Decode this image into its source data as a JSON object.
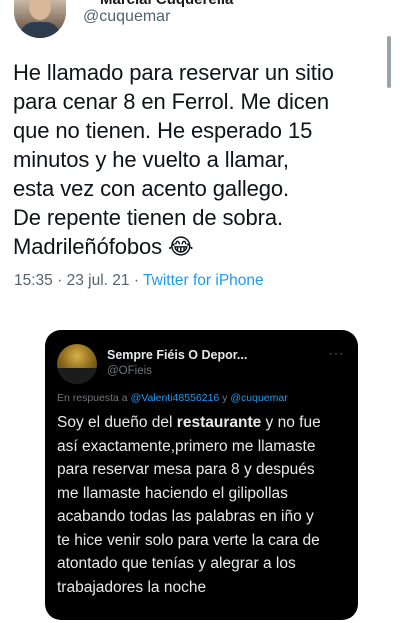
{
  "top_tweet": {
    "author_name": "Marcial Cuquerella",
    "handle": "@cuquemar",
    "text": "He llamado para reservar un sitio\npara cenar 8 en Ferrol. Me dicen\nque no tienen. He esperado 15\nminutos y he vuelto a llamar,\nesta vez con acento gallego.\nDe repente tienen de sobra.\nMadrileñófobos 😂",
    "time": "15:35",
    "date": "23 jul. 21",
    "separator": "·",
    "source": "Twitter for iPhone"
  },
  "reply": {
    "author_name": "Sempre Fiéis O Depor...",
    "handle": "@OFieis",
    "reply_prefix": "En respuesta a",
    "mention_1": "@Valenti48556216",
    "conjunction": "y",
    "mention_2": "@cuquemar",
    "text_before": "Soy el dueño del ",
    "text_bold": "restaurante",
    "text_after": " y no fue\nasí exactamente,primero me llamaste\npara reservar mesa para 8 y después\nme llamaste haciendo el gilipollas\nacabando todas las palabras en iño y\nte hice venir solo para verte la cara de\natontado que tenías y alegrar a los\ntrabajadores la noche",
    "more_icon": "···"
  }
}
